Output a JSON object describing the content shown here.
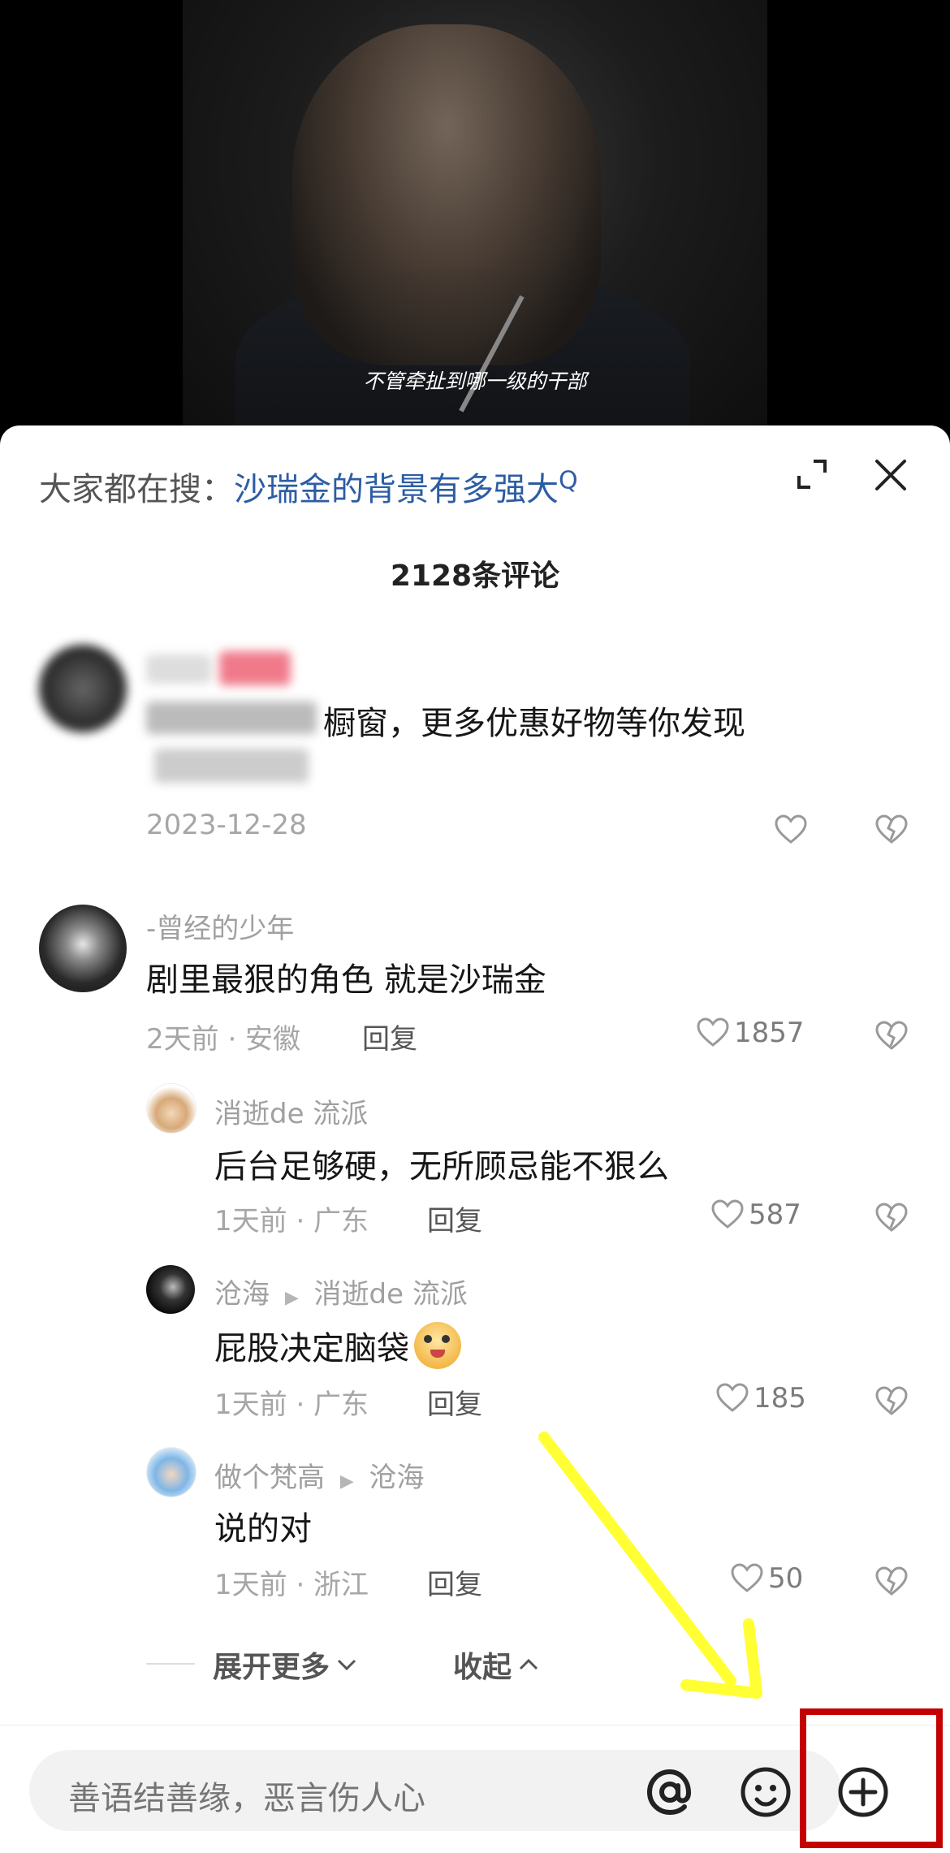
{
  "video": {
    "subtitle": "不管牵扯到哪一级的干部"
  },
  "search": {
    "prefix": "大家都在搜：",
    "query": "沙瑞金的背景有多强大",
    "query_icon": "Q"
  },
  "comments_header": {
    "count_label": "2128条评论"
  },
  "comments": [
    {
      "username": "",
      "text_visible": "橱窗，更多优惠好物等你发现",
      "time": "2023-12-28",
      "blurred": true
    },
    {
      "username": "-曾经的少年",
      "text": "剧里最狠的角色 就是沙瑞金",
      "time": "2天前 · 安徽",
      "reply": "回复",
      "likes": "1857"
    },
    {
      "username": "消逝de 流派",
      "text": "后台足够硬，无所顾忌能不狠么",
      "time": "1天前 · 广东",
      "reply": "回复",
      "likes": "587"
    },
    {
      "username": "沧海",
      "reply_to": "消逝de 流派",
      "text": "屁股决定脑袋",
      "time": "1天前 · 广东",
      "reply": "回复",
      "likes": "185"
    },
    {
      "username": "做个梵高",
      "reply_to": "沧海",
      "text": "说的对",
      "time": "1天前 · 浙江",
      "reply": "回复",
      "likes": "50"
    }
  ],
  "expand": {
    "more": "展开更多",
    "collapse": "收起"
  },
  "composer": {
    "placeholder": "善语结善缘，恶言伤人心"
  },
  "colors": {
    "accent": "#2c5da3",
    "highlight": "#c40000",
    "arrow": "#ffff33"
  }
}
